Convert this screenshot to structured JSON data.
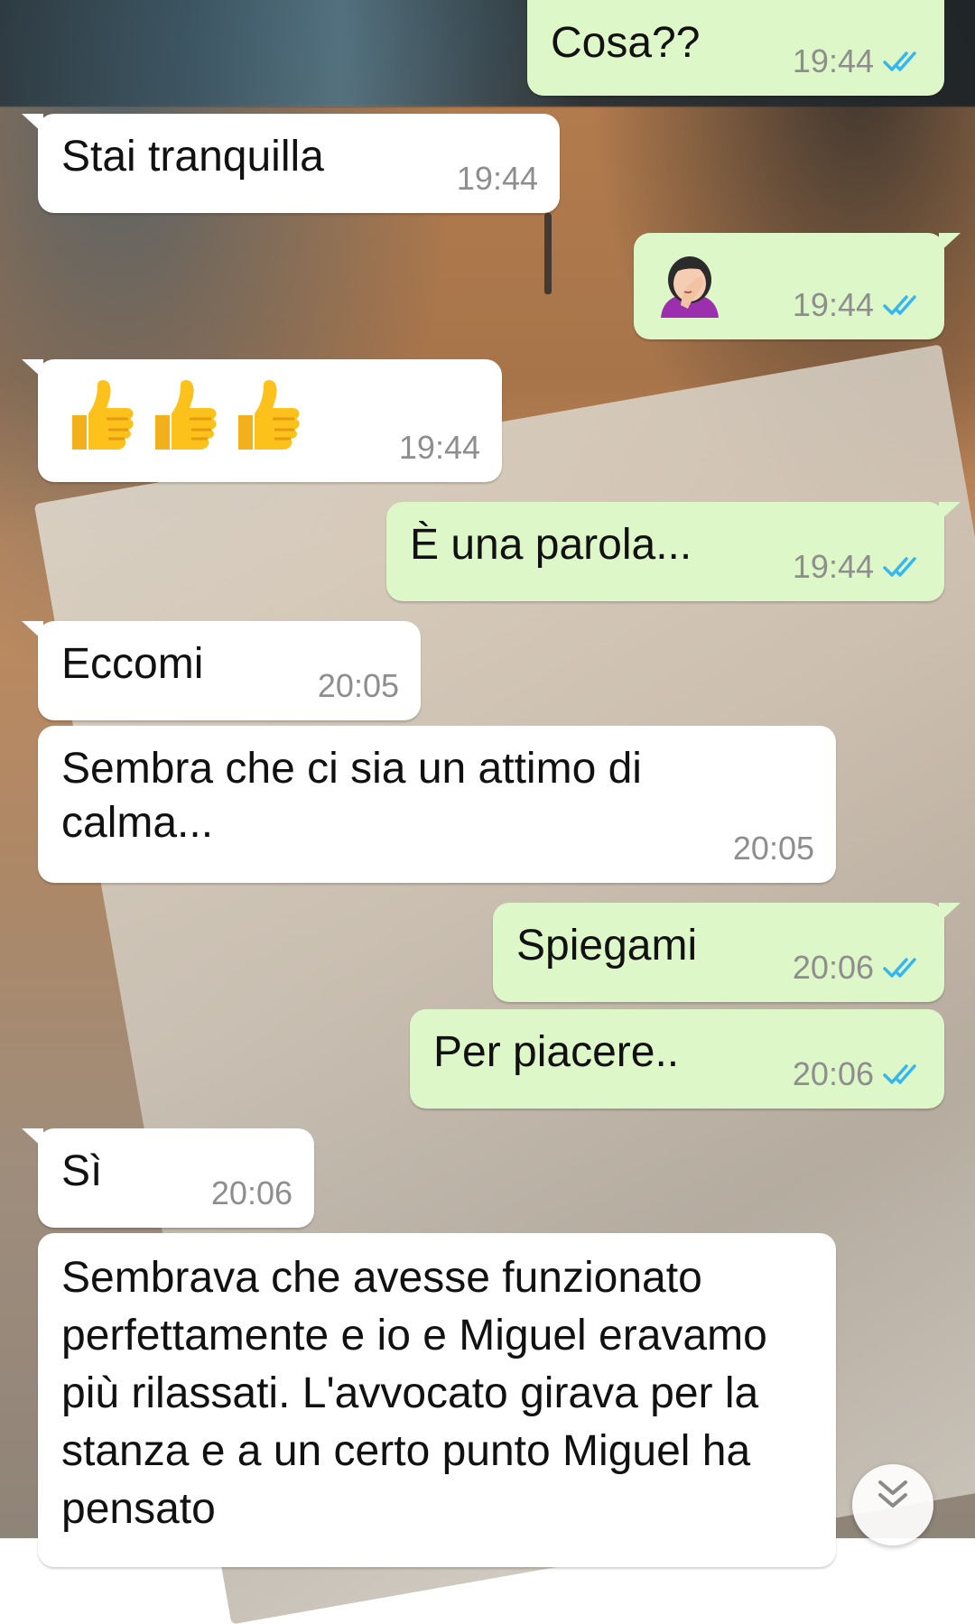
{
  "colors": {
    "incoming_bubble": "#ffffff",
    "outgoing_bubble": "#ddf7c8",
    "read_ticks": "#34b7f1",
    "time_text": "#8e8e8e"
  },
  "messages": [
    {
      "direction": "outgoing",
      "text": "Cosa??",
      "time": "19:44",
      "status": "read"
    },
    {
      "direction": "incoming",
      "text": "Stai tranquilla",
      "time": "19:44"
    },
    {
      "direction": "outgoing",
      "emoji": "woman-facepalming-icon",
      "time": "19:44",
      "status": "read"
    },
    {
      "direction": "incoming",
      "emoji": "thumbs-up-icon x3",
      "time": "19:44"
    },
    {
      "direction": "outgoing",
      "text": "È una parola...",
      "time": "19:44",
      "status": "read"
    },
    {
      "direction": "incoming",
      "text": "Eccomi",
      "time": "20:05"
    },
    {
      "direction": "incoming",
      "text": "Sembra che ci sia un attimo di calma...",
      "time": "20:05"
    },
    {
      "direction": "outgoing",
      "text": "Spiegami",
      "time": "20:06",
      "status": "read"
    },
    {
      "direction": "outgoing",
      "text": "Per piacere..",
      "time": "20:06",
      "status": "read"
    },
    {
      "direction": "incoming",
      "text": "Sì",
      "time": "20:06"
    },
    {
      "direction": "incoming",
      "text": "Sembrava che avesse funzionato perfettamente e io e Miguel eravamo più rilassati. L'avvocato girava per la stanza e a un certo punto Miguel ha pensato"
    }
  ],
  "scroll_button": {
    "icon": "double-chevron-down-icon"
  }
}
